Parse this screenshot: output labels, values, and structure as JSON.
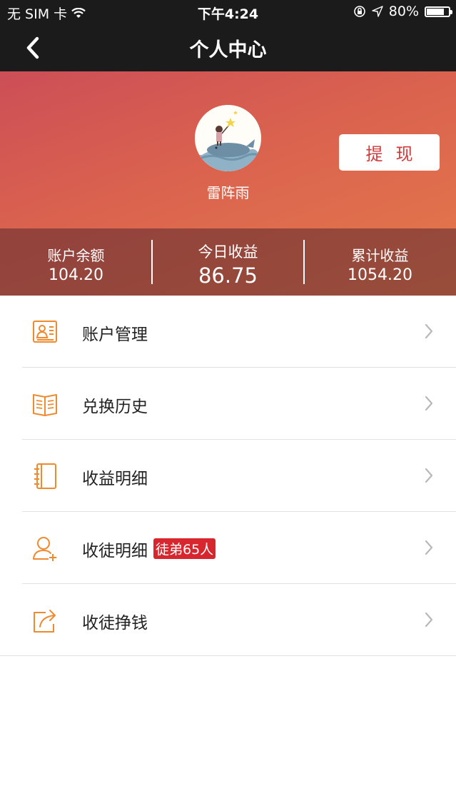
{
  "status_bar": {
    "carrier": "无 SIM 卡",
    "time": "下午4:24",
    "battery_percent": "80%",
    "battery_level": 0.8
  },
  "nav": {
    "title": "个人中心"
  },
  "profile": {
    "username": "雷阵雨",
    "withdraw_label": "提现"
  },
  "stats": [
    {
      "label": "账户余额",
      "value": "104.20"
    },
    {
      "label": "今日收益",
      "value": "86.75"
    },
    {
      "label": "累计收益",
      "value": "1054.20"
    }
  ],
  "menu": [
    {
      "label": "账户管理",
      "icon": "id-card-icon"
    },
    {
      "label": "兑换历史",
      "icon": "open-book-icon"
    },
    {
      "label": "收益明细",
      "icon": "notebook-icon"
    },
    {
      "label": "收徒明细",
      "icon": "add-person-icon",
      "badge": "徒弟65人"
    },
    {
      "label": "收徒挣钱",
      "icon": "share-icon"
    }
  ],
  "colors": {
    "accent_orange": "#ef8a2e",
    "withdraw_red": "#d23a3a",
    "badge_red": "#d8262f",
    "nav_bg": "#1b1b1b"
  }
}
